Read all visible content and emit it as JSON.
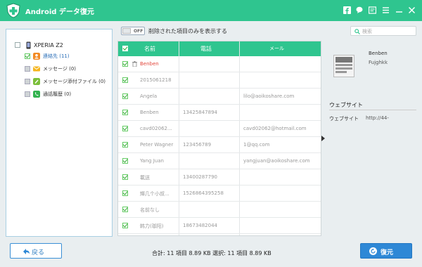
{
  "app": {
    "title": "Android データ復元",
    "accent": "#2fc58f"
  },
  "title_icons": [
    "facebook-icon",
    "chat-icon",
    "feedback-icon",
    "menu-icon",
    "minimize-icon",
    "close-icon"
  ],
  "sidebar": {
    "device": "XPERIA Z2",
    "items": [
      {
        "label": "連絡先 (11)",
        "checked": "full",
        "icon": "contacts-icon",
        "color": "#f28a24",
        "active": true
      },
      {
        "label": "メッセージ (0)",
        "checked": "partial",
        "icon": "message-icon",
        "color": "#f5b51e"
      },
      {
        "label": "メッセージ添付ファイル (0)",
        "checked": "partial",
        "icon": "attachment-icon",
        "color": "#7bbf3a"
      },
      {
        "label": "通話履歴 (0)",
        "checked": "partial",
        "icon": "call-icon",
        "color": "#32b24f"
      }
    ]
  },
  "toolbar": {
    "toggle_label": "OFF",
    "toggle_desc": "削除された項目のみを表示する",
    "search_placeholder": "検索"
  },
  "table": {
    "headers": [
      "名前",
      "電話",
      "メール"
    ],
    "rows": [
      {
        "name": "Benben",
        "phone": "",
        "email": "",
        "deleted": true
      },
      {
        "name": "2015061218",
        "phone": "",
        "email": ""
      },
      {
        "name": "Angela",
        "phone": "",
        "email": "lilo@aoikoshare.com"
      },
      {
        "name": "Benben",
        "phone": "13425847894",
        "email": ""
      },
      {
        "name": "cavd02062...",
        "phone": "",
        "email": "cavd02062@hotmail.com"
      },
      {
        "name": "Peter Wagner",
        "phone": "123456789",
        "email": "1@qq.com"
      },
      {
        "name": "Yang Juan",
        "phone": "",
        "email": "yangjuan@aoikoshare.com"
      },
      {
        "name": "載送",
        "phone": "13400287790",
        "email": ""
      },
      {
        "name": "輝几个小叔...",
        "phone": "1526864395258",
        "email": ""
      },
      {
        "name": "名前なし",
        "phone": "",
        "email": ""
      },
      {
        "name": "韩力(珈阳)",
        "phone": "18673482044",
        "email": ""
      }
    ]
  },
  "detail": {
    "name": "Benben",
    "company": "Fujghkk",
    "section_title": "ウェブサイト",
    "field_label": "ウェブサイト",
    "field_value": "http://44-"
  },
  "footer": {
    "back_label": "戻る",
    "summary": "合計: 11 項目 8.89 KB  選択: 11 項目 8.89 KB",
    "restore_label": "復元"
  }
}
